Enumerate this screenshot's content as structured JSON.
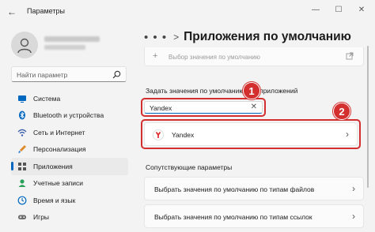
{
  "window": {
    "title": "Параметры",
    "controls": {
      "minimize": "—",
      "maximize": "☐",
      "close": "✕"
    },
    "back_icon": "arrow-left-icon"
  },
  "sidebar": {
    "search_placeholder": "Найти параметр",
    "items": [
      {
        "label": "Система",
        "icon": "monitor-icon",
        "color": "#0067c0"
      },
      {
        "label": "Bluetooth и устройства",
        "icon": "bluetooth-icon",
        "color": "#0067c0"
      },
      {
        "label": "Сеть и Интернет",
        "icon": "wifi-icon",
        "color": "#3a5ea8"
      },
      {
        "label": "Персонализация",
        "icon": "brush-icon",
        "color": "#e08a2a"
      },
      {
        "label": "Приложения",
        "icon": "apps-icon",
        "color": "#555555",
        "active": true
      },
      {
        "label": "Учетные записи",
        "icon": "account-icon",
        "color": "#2aa05a"
      },
      {
        "label": "Время и язык",
        "icon": "globe-clock-icon",
        "color": "#0067c0"
      },
      {
        "label": "Игры",
        "icon": "gamepad-icon",
        "color": "#6a6a6a"
      }
    ]
  },
  "main": {
    "breadcrumb_dots": "• • •",
    "breadcrumb_sep": ">",
    "title": "Приложения по умолчанию",
    "top_card": {
      "label": "Выбор значения по умолчанию"
    },
    "section1": "Задать значения по умолчанию для приложений",
    "app_search": {
      "value": "Yandex",
      "clear": "✕"
    },
    "result": {
      "label": "Yandex",
      "chevron": "›"
    },
    "section2": "Сопутствующие параметры",
    "related": [
      {
        "label": "Выбрать значения по умолчанию по типам файлов",
        "chevron": "›"
      },
      {
        "label": "Выбрать значения по умолчанию по типам ссылок",
        "chevron": "›"
      }
    ]
  },
  "annotations": {
    "badge1": "1",
    "badge2": "2",
    "highlight_color": "#d32f2f"
  },
  "colors": {
    "accent": "#0067c0",
    "background": "#f3f3f3"
  }
}
